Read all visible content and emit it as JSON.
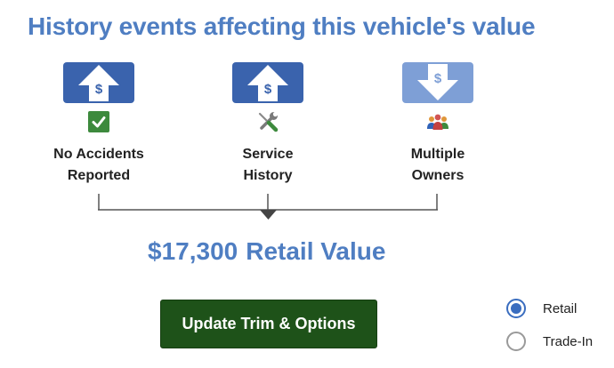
{
  "header": {
    "title": "History events affecting this vehicle's value"
  },
  "events": [
    {
      "label_line1": "No Accidents",
      "label_line2": "Reported",
      "value_icon": "value-up-arrow-icon",
      "sub_icon": "checkmark-icon",
      "effect": "increase"
    },
    {
      "label_line1": "Service",
      "label_line2": "History",
      "value_icon": "value-up-arrow-icon",
      "sub_icon": "tools-icon",
      "effect": "increase"
    },
    {
      "label_line1": "Multiple",
      "label_line2": "Owners",
      "value_icon": "value-down-arrow-icon",
      "sub_icon": "people-icon",
      "effect": "decrease"
    }
  ],
  "value_summary": {
    "price": "$17,300",
    "label": "Retail Value"
  },
  "actions": {
    "update_label": "Update Trim & Options"
  },
  "value_type": {
    "selected": "Retail",
    "options": [
      {
        "label": "Retail",
        "checked": true
      },
      {
        "label": "Trade-In",
        "checked": false
      }
    ]
  },
  "colors": {
    "accent_blue": "#4f7ec2",
    "increase_blue": "#3a63ad",
    "decrease_blue": "#7e9fd6",
    "button_green": "#1e5219",
    "check_green": "#3d8a3d",
    "radio_blue": "#3a6dbf"
  }
}
